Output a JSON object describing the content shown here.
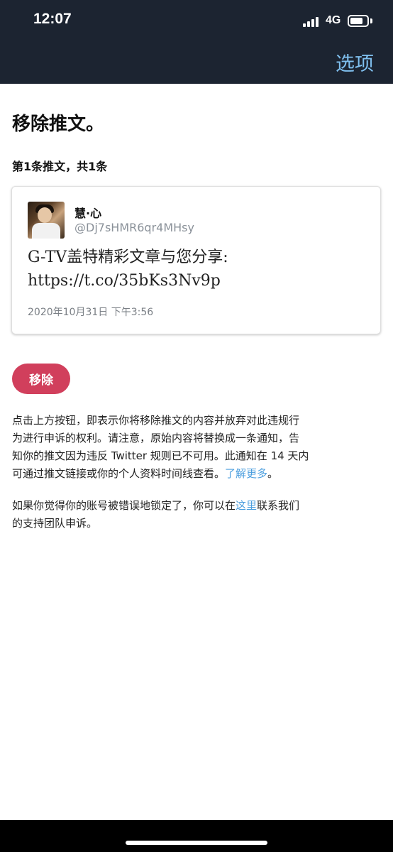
{
  "status_bar": {
    "time": "12:07",
    "network": "4G"
  },
  "header": {
    "options_label": "选项"
  },
  "page": {
    "title": "移除推文。",
    "count_label": "第1条推文，共1条"
  },
  "tweet": {
    "display_name": "慧·心",
    "handle": "@Dj7sHMR6qr4MHsy",
    "text_line1": "G-TV盖特精彩文章与您分享:",
    "text_line2": "https://t.co/35bKs3Nv9p",
    "timestamp": "2020年10月31日 下午3:56"
  },
  "remove_button_label": "移除",
  "info": {
    "para1_line1": "点击上方按钮，即表示你将移除推文的内容并放弃对此违规行",
    "para1_line2": "为进行申诉的权利。请注意，原始内容将替换成一条通知，告",
    "para1_line3": "知你的推文因为违反 Twitter 规则已不可用。此通知在 14 天内",
    "para1_line4_prefix": "可通过推文链接或你的个人资料时间线查看。",
    "learn_more_link": "了解更多",
    "para1_line4_suffix": "。",
    "para2_line1_prefix": "如果你觉得你的账号被错误地锁定了，你可以在",
    "here_link": "这里",
    "para2_line1_suffix": "联系我们",
    "para2_line2": "的支持团队申诉。"
  },
  "colors": {
    "header_bg": "#1c2431",
    "accent_link": "#4b9ede",
    "options_text": "#7fbfee",
    "remove_button": "#d13f5c"
  }
}
